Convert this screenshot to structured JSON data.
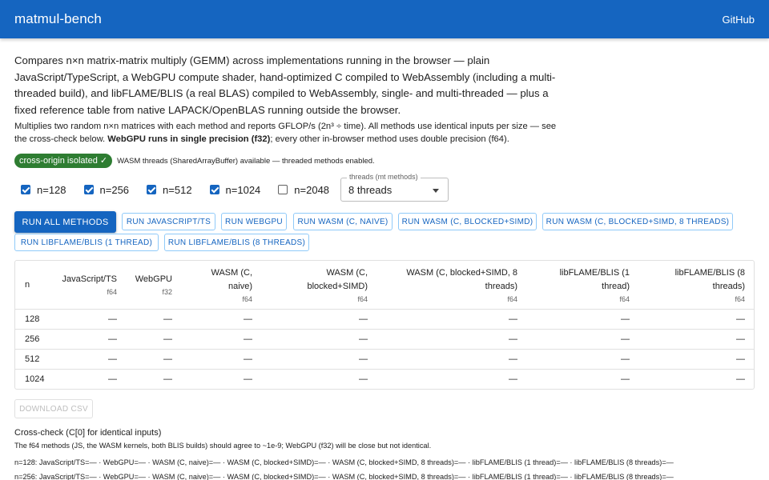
{
  "appbar": {
    "title": "matmul-bench",
    "github": "GitHub"
  },
  "intro": "Compares n×n matrix-matrix multiply (GEMM) across implementations running in the browser — plain JavaScript/TypeScript, a WebGPU compute shader, hand-optimized C compiled to WebAssembly (including a multi-threaded build), and libFLAME/BLIS (a real BLAS) compiled to WebAssembly, single- and multi-threaded — plus a fixed reference table from native LAPACK/OpenBLAS running outside the browser.",
  "sub": {
    "pre": "Multiplies two random n×n matrices with each method and reports GFLOP/s (2n³ ÷ time). All methods use identical inputs per size — see the cross-check below. ",
    "bold": "WebGPU runs in single precision (f32)",
    "post": "; every other in-browser method uses double precision (f64)."
  },
  "status": {
    "chip": "cross-origin isolated ✓",
    "note": "WASM threads (SharedArrayBuffer) available — threaded methods enabled."
  },
  "sizes": [
    {
      "label": "n=128",
      "checked": true
    },
    {
      "label": "n=256",
      "checked": true
    },
    {
      "label": "n=512",
      "checked": true
    },
    {
      "label": "n=1024",
      "checked": true
    },
    {
      "label": "n=2048",
      "checked": false
    }
  ],
  "threads": {
    "label": "threads (mt methods)",
    "value": "8 threads"
  },
  "buttons": {
    "run_all": "RUN ALL METHODS",
    "js": "RUN JAVASCRIPT/TS",
    "webgpu": "RUN WEBGPU",
    "wasm_naive": "RUN WASM (C, NAIVE)",
    "wasm_blocked": "RUN WASM (C, BLOCKED+SIMD)",
    "wasm_blocked_8": "RUN WASM (C, BLOCKED+SIMD, 8 THREADS)",
    "blis_1": "RUN LIBFLAME/BLIS (1 THREAD)",
    "blis_8": "RUN LIBFLAME/BLIS (8 THREADS)"
  },
  "table": {
    "headers": [
      {
        "l1": "n",
        "l2": "",
        "prec": ""
      },
      {
        "l1": "JavaScript/TS",
        "l2": "",
        "prec": "f64"
      },
      {
        "l1": "WebGPU",
        "l2": "",
        "prec": "f32"
      },
      {
        "l1": "WASM (C,",
        "l2": "naive)",
        "prec": "f64"
      },
      {
        "l1": "WASM (C,",
        "l2": "blocked+SIMD)",
        "prec": "f64"
      },
      {
        "l1": "WASM (C, blocked+SIMD, 8",
        "l2": "threads)",
        "prec": "f64"
      },
      {
        "l1": "libFLAME/BLIS (1",
        "l2": "thread)",
        "prec": "f64"
      },
      {
        "l1": "libFLAME/BLIS (8",
        "l2": "threads)",
        "prec": "f64"
      }
    ],
    "rows": [
      [
        "128",
        "—",
        "—",
        "—",
        "—",
        "—",
        "—",
        "—"
      ],
      [
        "256",
        "—",
        "—",
        "—",
        "—",
        "—",
        "—",
        "—"
      ],
      [
        "512",
        "—",
        "—",
        "—",
        "—",
        "—",
        "—",
        "—"
      ],
      [
        "1024",
        "—",
        "—",
        "—",
        "—",
        "—",
        "—",
        "—"
      ]
    ]
  },
  "download": "DOWNLOAD CSV",
  "crosscheck": {
    "title": "Cross-check (C[0] for identical inputs)",
    "note": "The f64 methods (JS, the WASM kernels, both BLIS builds) should agree to ~1e-9; WebGPU (f32) will be close but not identical.",
    "lines": [
      "n=128: JavaScript/TS=— · WebGPU=— · WASM (C, naive)=— · WASM (C, blocked+SIMD)=— · WASM (C, blocked+SIMD, 8 threads)=— · libFLAME/BLIS (1 thread)=— · libFLAME/BLIS (8 threads)=—",
      "n=256: JavaScript/TS=— · WebGPU=— · WASM (C, naive)=— · WASM (C, blocked+SIMD)=— · WASM (C, blocked+SIMD, 8 threads)=— · libFLAME/BLIS (1 thread)=— · libFLAME/BLIS (8 threads)=—"
    ]
  }
}
